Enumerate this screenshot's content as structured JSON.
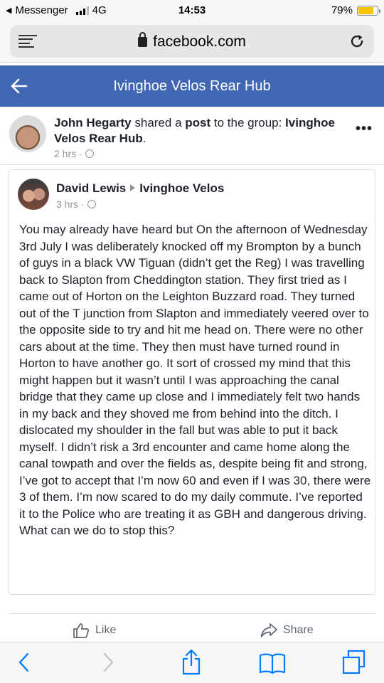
{
  "status_bar": {
    "back_app": "Messenger",
    "network": "4G",
    "time": "14:53",
    "battery": "79%",
    "battery_level": 0.79
  },
  "browser": {
    "url": "facebook.com"
  },
  "header": {
    "title": "Ivinghoe Velos Rear Hub"
  },
  "post": {
    "author": "John Hegarty",
    "shared_text": " shared a ",
    "post_word": "post",
    "to_group_text": " to the group: ",
    "group": "Ivinghoe Velos Rear Hub",
    "period": ".",
    "time": "2 hrs · "
  },
  "shared": {
    "author": "David Lewis",
    "group": "Ivinghoe Velos",
    "time": "3 hrs · ",
    "body": "You may already have heard but On the afternoon of Wednesday 3rd July I was deliberately knocked off my Brompton by a bunch of guys in a black VW Tiguan (didn’t get the Reg) I was travelling back to Slapton from Cheddington station. They first tried as I came out of Horton on the Leighton Buzzard road. They turned out of the T junction from Slapton and immediately veered over to the opposite side to try and hit me head on. There were no other cars about at the time. They then must have turned round in Horton to have another go. It sort of crossed my mind that this might happen but it wasn’t until I was approaching the canal bridge that they came up close and I immediately felt two hands in my back and they shoved me from behind into the ditch. I dislocated my shoulder in the fall but was able to put it back myself. I didn’t risk a 3rd encounter and came home along the canal towpath and over the fields as, despite being fit and strong, I’ve got to accept that I’m now 60 and even if I was 30, there were 3 of them. I’m now scared to do my daily commute. I’ve reported it to the Police who are treating it as GBH and dangerous driving. What can we do to stop this?"
  },
  "actions": {
    "like": "Like",
    "share": "Share"
  },
  "colors": {
    "facebook_blue": "#4267b2",
    "battery_yellow": "#f5c300",
    "safari_blue": "#007aff"
  }
}
